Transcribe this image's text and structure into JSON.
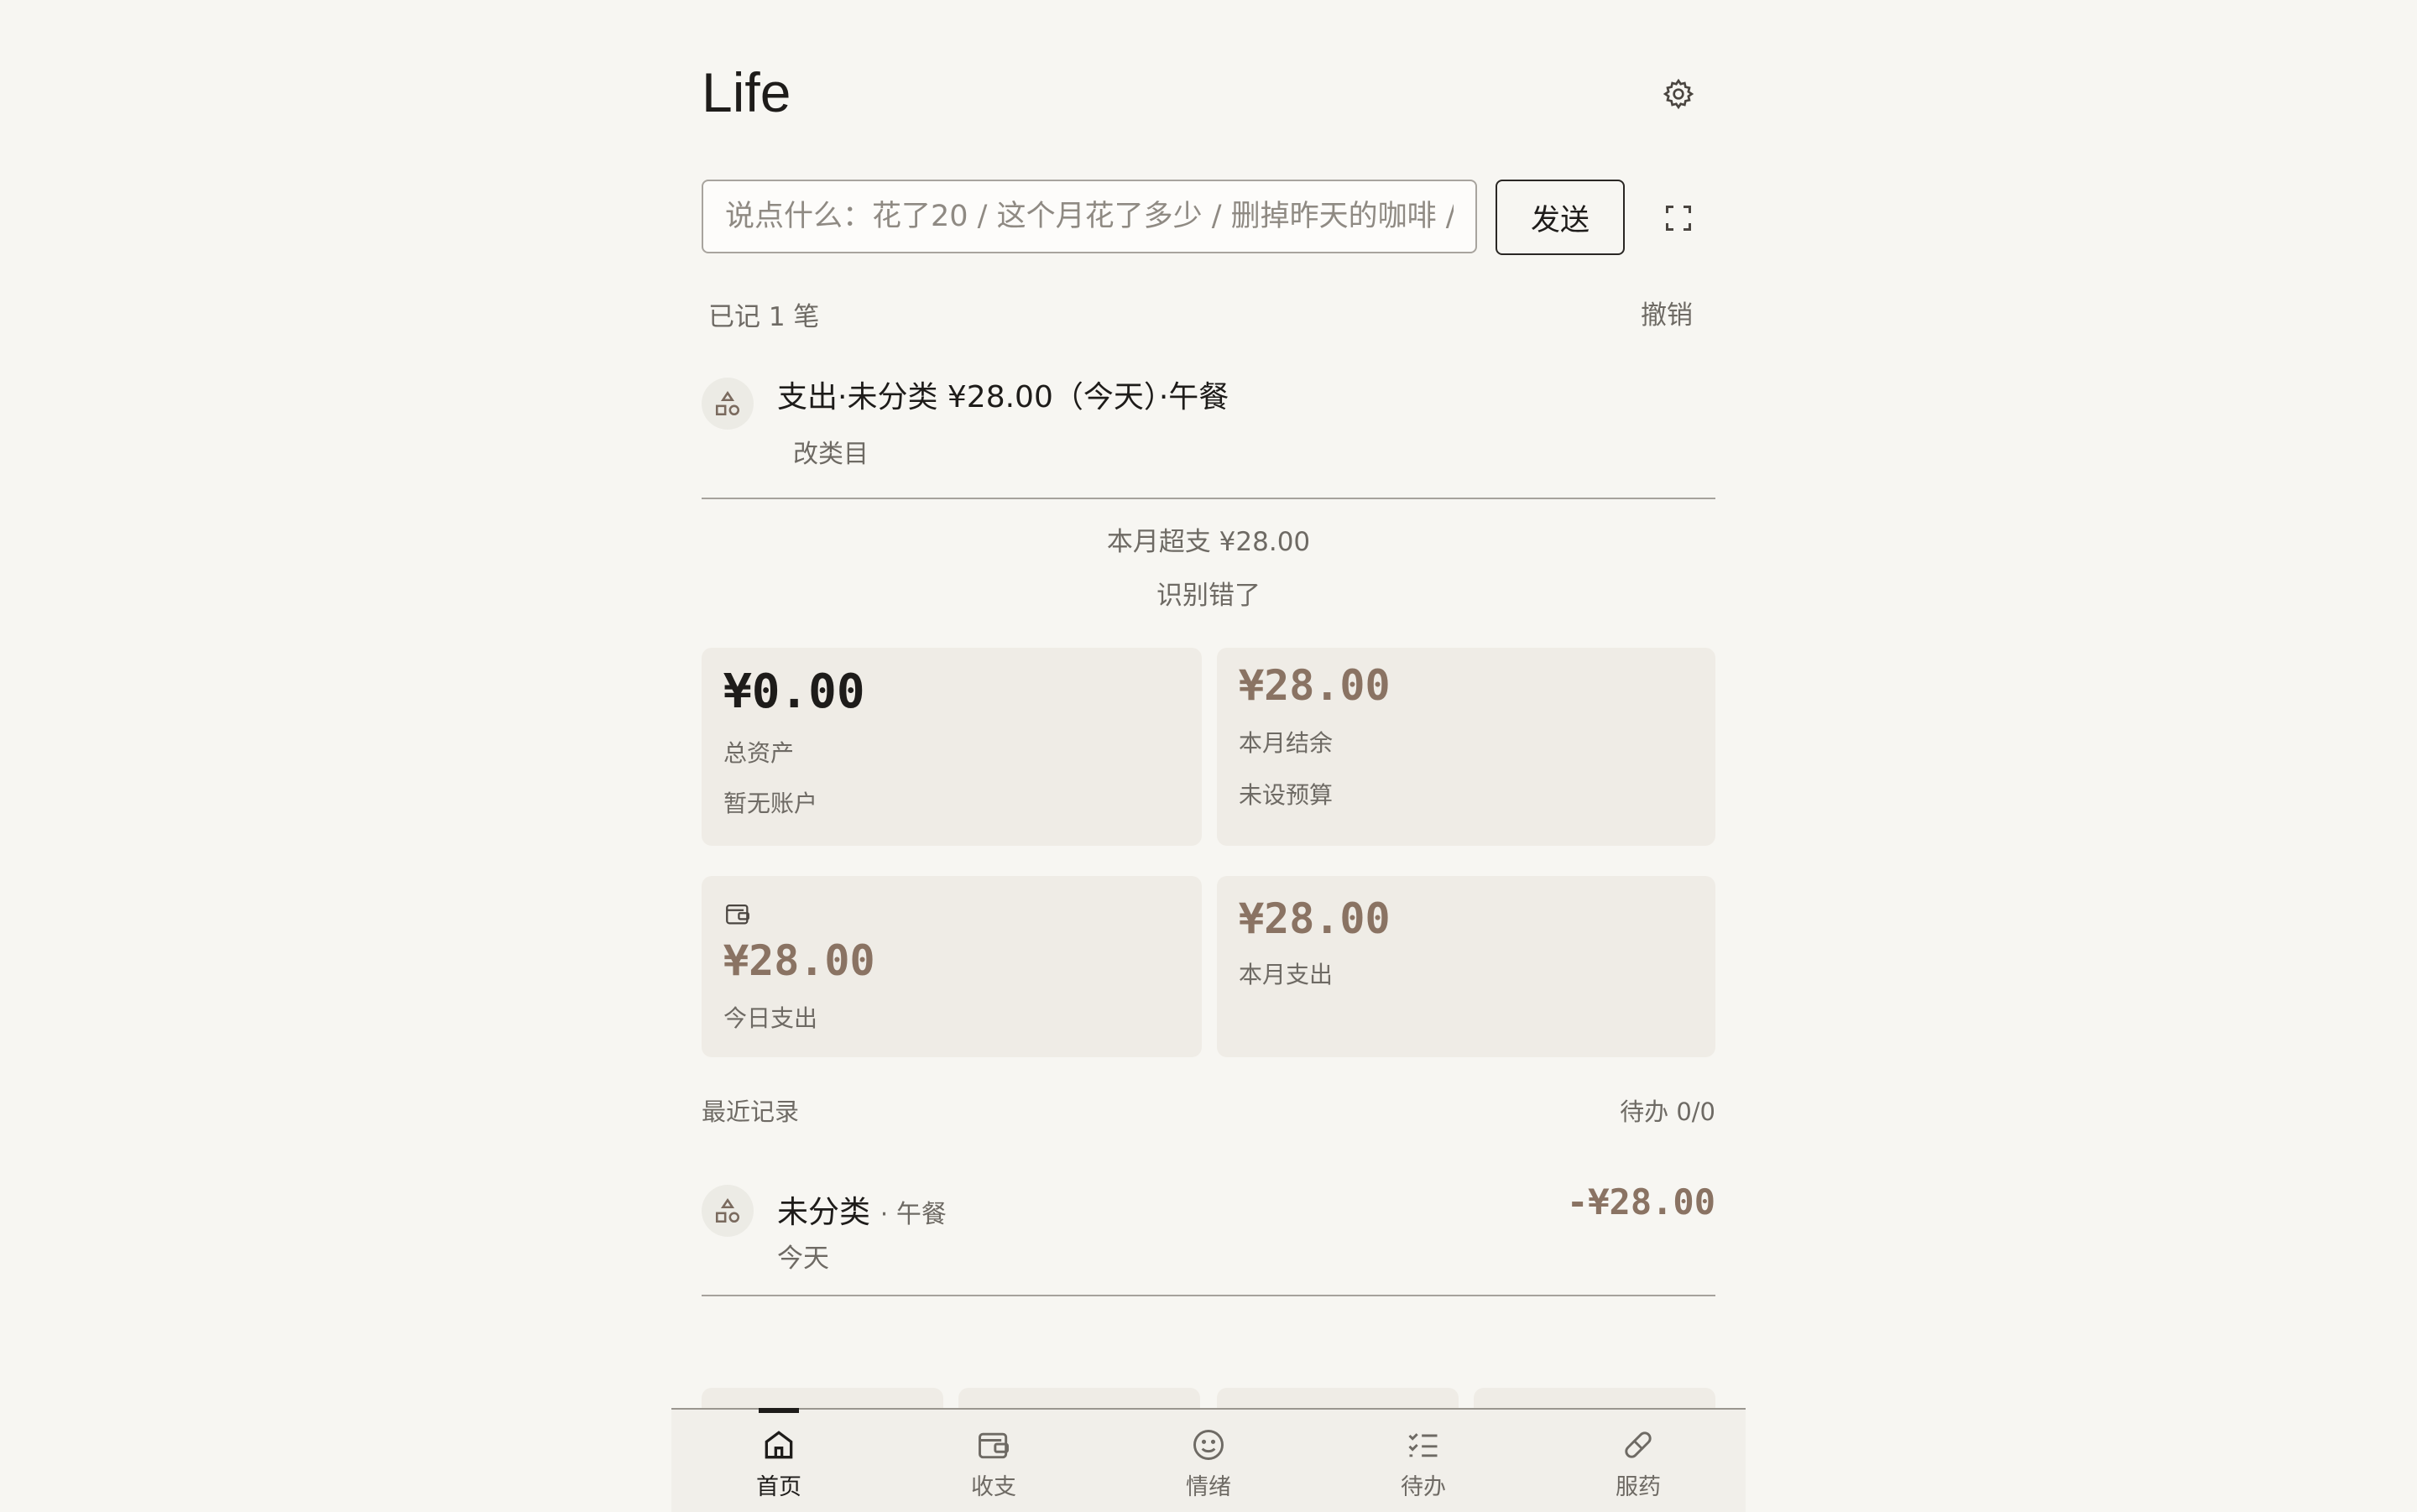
{
  "app": {
    "title": "Life"
  },
  "composer": {
    "placeholder": "说点什么：花了20 / 这个月花了多少 / 删掉昨天的咖啡 / ...",
    "send_label": "发送"
  },
  "status": {
    "logged": "已记 1 笔",
    "undo_label": "撤销"
  },
  "parsed_entry": {
    "text": "支出·未分类 ¥28.00（今天）·午餐",
    "action_label": "改类目",
    "icon": "category-shapes-icon"
  },
  "budget_note": "本月超支 ¥28.00",
  "wrong_label": "识别错了",
  "cards": {
    "total_assets": {
      "value": "¥0.00",
      "label": "总资产",
      "sub": "暂无账户"
    },
    "month_balance": {
      "value": "¥28.00",
      "label": "本月结余",
      "sub": "未设预算"
    },
    "today_spend": {
      "value": "¥28.00",
      "label": "今日支出",
      "icon": "wallet-icon"
    },
    "month_spend": {
      "value": "¥28.00",
      "label": "本月支出"
    }
  },
  "recent": {
    "heading": "最近记录",
    "todo_summary": "待办 0/0",
    "items": [
      {
        "category": "未分类",
        "separator": "·",
        "note": "午餐",
        "date": "今天",
        "amount": "-¥28.00",
        "icon": "category-shapes-icon"
      }
    ]
  },
  "tabs": [
    {
      "label": "首页",
      "icon": "home-icon",
      "active": true
    },
    {
      "label": "收支",
      "icon": "wallet-icon",
      "active": false
    },
    {
      "label": "情绪",
      "icon": "smiley-icon",
      "active": false
    },
    {
      "label": "待办",
      "icon": "checklist-icon",
      "active": false
    },
    {
      "label": "服药",
      "icon": "pill-icon",
      "active": false
    }
  ],
  "colors": {
    "background": "#f7f6f2",
    "card": "#efece6",
    "accent_brown": "#8a7363",
    "text": "#1e1c1a",
    "muted": "#6e6a64"
  }
}
